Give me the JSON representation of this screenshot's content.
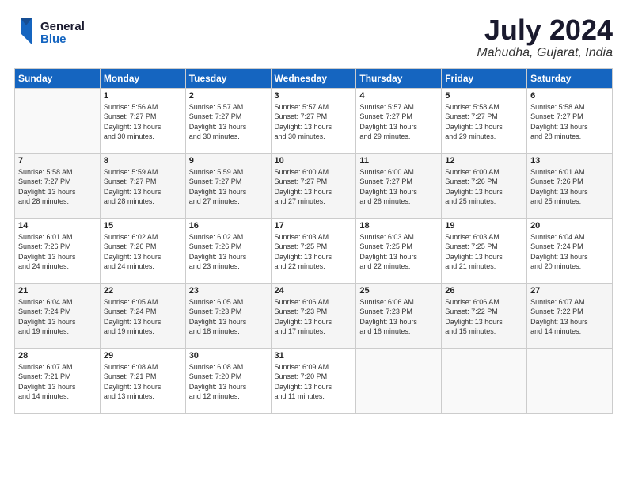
{
  "header": {
    "logo_general": "General",
    "logo_blue": "Blue",
    "month_title": "July 2024",
    "location": "Mahudha, Gujarat, India"
  },
  "days_of_week": [
    "Sunday",
    "Monday",
    "Tuesday",
    "Wednesday",
    "Thursday",
    "Friday",
    "Saturday"
  ],
  "weeks": [
    [
      {
        "day": "",
        "info": ""
      },
      {
        "day": "1",
        "info": "Sunrise: 5:56 AM\nSunset: 7:27 PM\nDaylight: 13 hours\nand 30 minutes."
      },
      {
        "day": "2",
        "info": "Sunrise: 5:57 AM\nSunset: 7:27 PM\nDaylight: 13 hours\nand 30 minutes."
      },
      {
        "day": "3",
        "info": "Sunrise: 5:57 AM\nSunset: 7:27 PM\nDaylight: 13 hours\nand 30 minutes."
      },
      {
        "day": "4",
        "info": "Sunrise: 5:57 AM\nSunset: 7:27 PM\nDaylight: 13 hours\nand 29 minutes."
      },
      {
        "day": "5",
        "info": "Sunrise: 5:58 AM\nSunset: 7:27 PM\nDaylight: 13 hours\nand 29 minutes."
      },
      {
        "day": "6",
        "info": "Sunrise: 5:58 AM\nSunset: 7:27 PM\nDaylight: 13 hours\nand 28 minutes."
      }
    ],
    [
      {
        "day": "7",
        "info": "Sunrise: 5:58 AM\nSunset: 7:27 PM\nDaylight: 13 hours\nand 28 minutes."
      },
      {
        "day": "8",
        "info": "Sunrise: 5:59 AM\nSunset: 7:27 PM\nDaylight: 13 hours\nand 28 minutes."
      },
      {
        "day": "9",
        "info": "Sunrise: 5:59 AM\nSunset: 7:27 PM\nDaylight: 13 hours\nand 27 minutes."
      },
      {
        "day": "10",
        "info": "Sunrise: 6:00 AM\nSunset: 7:27 PM\nDaylight: 13 hours\nand 27 minutes."
      },
      {
        "day": "11",
        "info": "Sunrise: 6:00 AM\nSunset: 7:27 PM\nDaylight: 13 hours\nand 26 minutes."
      },
      {
        "day": "12",
        "info": "Sunrise: 6:00 AM\nSunset: 7:26 PM\nDaylight: 13 hours\nand 25 minutes."
      },
      {
        "day": "13",
        "info": "Sunrise: 6:01 AM\nSunset: 7:26 PM\nDaylight: 13 hours\nand 25 minutes."
      }
    ],
    [
      {
        "day": "14",
        "info": "Sunrise: 6:01 AM\nSunset: 7:26 PM\nDaylight: 13 hours\nand 24 minutes."
      },
      {
        "day": "15",
        "info": "Sunrise: 6:02 AM\nSunset: 7:26 PM\nDaylight: 13 hours\nand 24 minutes."
      },
      {
        "day": "16",
        "info": "Sunrise: 6:02 AM\nSunset: 7:26 PM\nDaylight: 13 hours\nand 23 minutes."
      },
      {
        "day": "17",
        "info": "Sunrise: 6:03 AM\nSunset: 7:25 PM\nDaylight: 13 hours\nand 22 minutes."
      },
      {
        "day": "18",
        "info": "Sunrise: 6:03 AM\nSunset: 7:25 PM\nDaylight: 13 hours\nand 22 minutes."
      },
      {
        "day": "19",
        "info": "Sunrise: 6:03 AM\nSunset: 7:25 PM\nDaylight: 13 hours\nand 21 minutes."
      },
      {
        "day": "20",
        "info": "Sunrise: 6:04 AM\nSunset: 7:24 PM\nDaylight: 13 hours\nand 20 minutes."
      }
    ],
    [
      {
        "day": "21",
        "info": "Sunrise: 6:04 AM\nSunset: 7:24 PM\nDaylight: 13 hours\nand 19 minutes."
      },
      {
        "day": "22",
        "info": "Sunrise: 6:05 AM\nSunset: 7:24 PM\nDaylight: 13 hours\nand 19 minutes."
      },
      {
        "day": "23",
        "info": "Sunrise: 6:05 AM\nSunset: 7:23 PM\nDaylight: 13 hours\nand 18 minutes."
      },
      {
        "day": "24",
        "info": "Sunrise: 6:06 AM\nSunset: 7:23 PM\nDaylight: 13 hours\nand 17 minutes."
      },
      {
        "day": "25",
        "info": "Sunrise: 6:06 AM\nSunset: 7:23 PM\nDaylight: 13 hours\nand 16 minutes."
      },
      {
        "day": "26",
        "info": "Sunrise: 6:06 AM\nSunset: 7:22 PM\nDaylight: 13 hours\nand 15 minutes."
      },
      {
        "day": "27",
        "info": "Sunrise: 6:07 AM\nSunset: 7:22 PM\nDaylight: 13 hours\nand 14 minutes."
      }
    ],
    [
      {
        "day": "28",
        "info": "Sunrise: 6:07 AM\nSunset: 7:21 PM\nDaylight: 13 hours\nand 14 minutes."
      },
      {
        "day": "29",
        "info": "Sunrise: 6:08 AM\nSunset: 7:21 PM\nDaylight: 13 hours\nand 13 minutes."
      },
      {
        "day": "30",
        "info": "Sunrise: 6:08 AM\nSunset: 7:20 PM\nDaylight: 13 hours\nand 12 minutes."
      },
      {
        "day": "31",
        "info": "Sunrise: 6:09 AM\nSunset: 7:20 PM\nDaylight: 13 hours\nand 11 minutes."
      },
      {
        "day": "",
        "info": ""
      },
      {
        "day": "",
        "info": ""
      },
      {
        "day": "",
        "info": ""
      }
    ]
  ]
}
